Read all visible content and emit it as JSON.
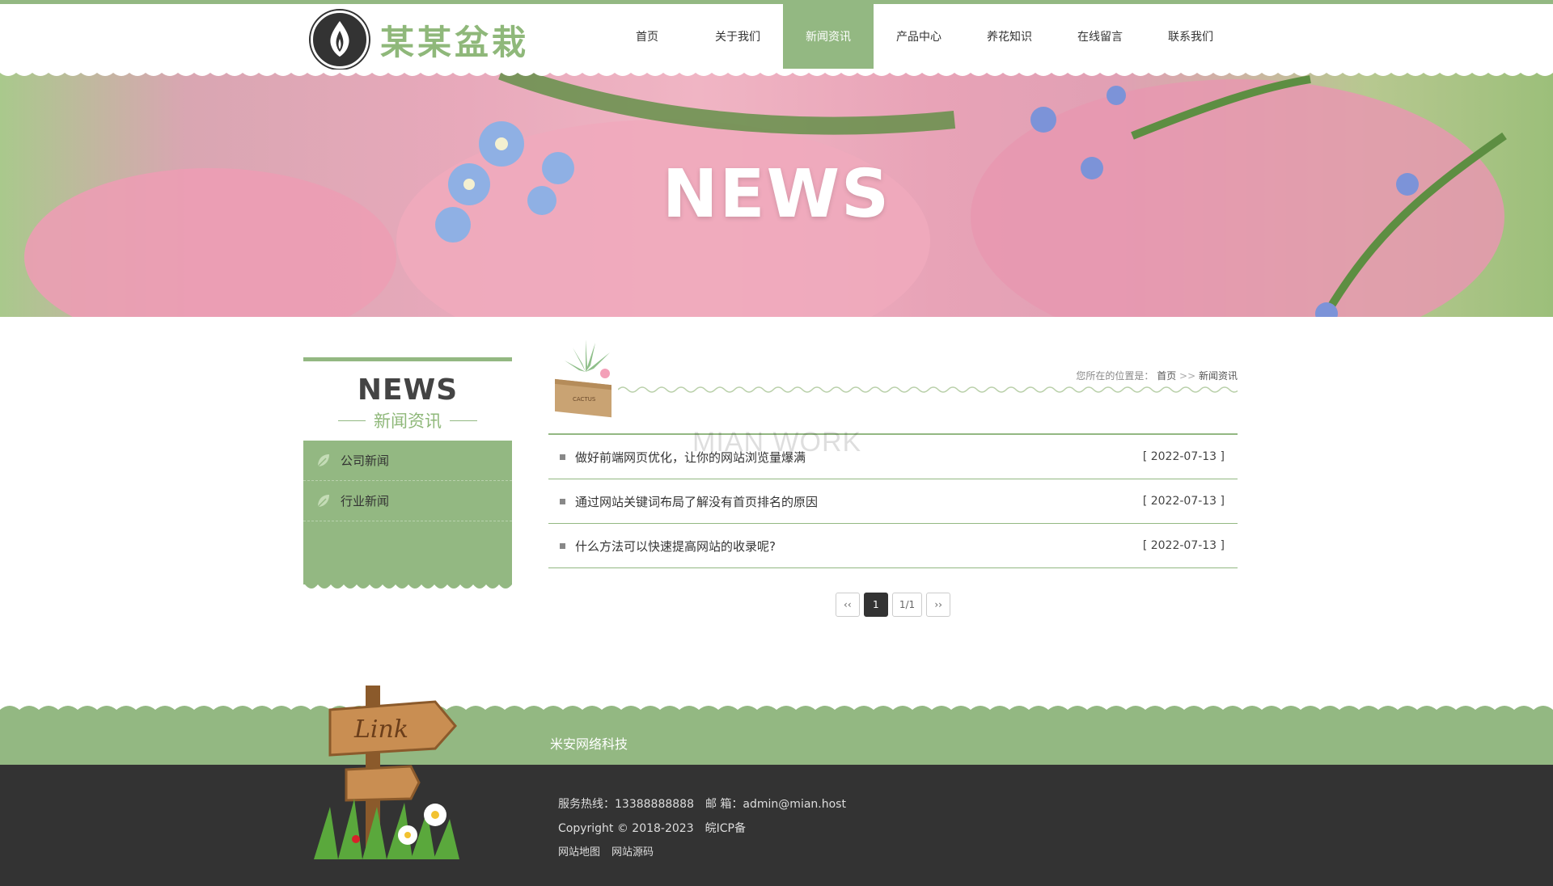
{
  "site": {
    "logo_text": "某某盆栽"
  },
  "nav": {
    "items": [
      {
        "label": "首页"
      },
      {
        "label": "关于我们"
      },
      {
        "label": "新闻资讯"
      },
      {
        "label": "产品中心"
      },
      {
        "label": "养花知识"
      },
      {
        "label": "在线留言"
      },
      {
        "label": "联系我们"
      }
    ],
    "active": "新闻资讯"
  },
  "banner": {
    "title": "NEWS"
  },
  "sidebar": {
    "title_en": "NEWS",
    "title_cn": "新闻资讯",
    "items": [
      {
        "label": "公司新闻"
      },
      {
        "label": "行业新闻"
      }
    ]
  },
  "breadcrumb": {
    "prefix": "您所在的位置是：",
    "home": "首页",
    "sep": ">>",
    "current": "新闻资讯"
  },
  "watermark": "MIAN WORK",
  "news": [
    {
      "title": "做好前端网页优化，让你的网站浏览量爆满",
      "date": "[ 2022-07-13 ]"
    },
    {
      "title": "通过网站关键词布局了解没有首页排名的原因",
      "date": "[ 2022-07-13 ]"
    },
    {
      "title": "什么方法可以快速提高网站的收录呢?",
      "date": "[ 2022-07-13 ]"
    }
  ],
  "pager": {
    "prev": "‹‹",
    "current": "1",
    "info": "1/1",
    "next": "››"
  },
  "footer": {
    "company": "米安网络科技",
    "hotline": "服务热线：13388888888",
    "email": "邮 箱：admin@mian.host",
    "copyright": "Copyright © 2018-2023",
    "icp": "皖ICP备",
    "links": [
      "网站地图",
      "网站源码"
    ],
    "sign_text": "Link"
  },
  "colors": {
    "accent": "#93b882",
    "dark": "#333333"
  }
}
